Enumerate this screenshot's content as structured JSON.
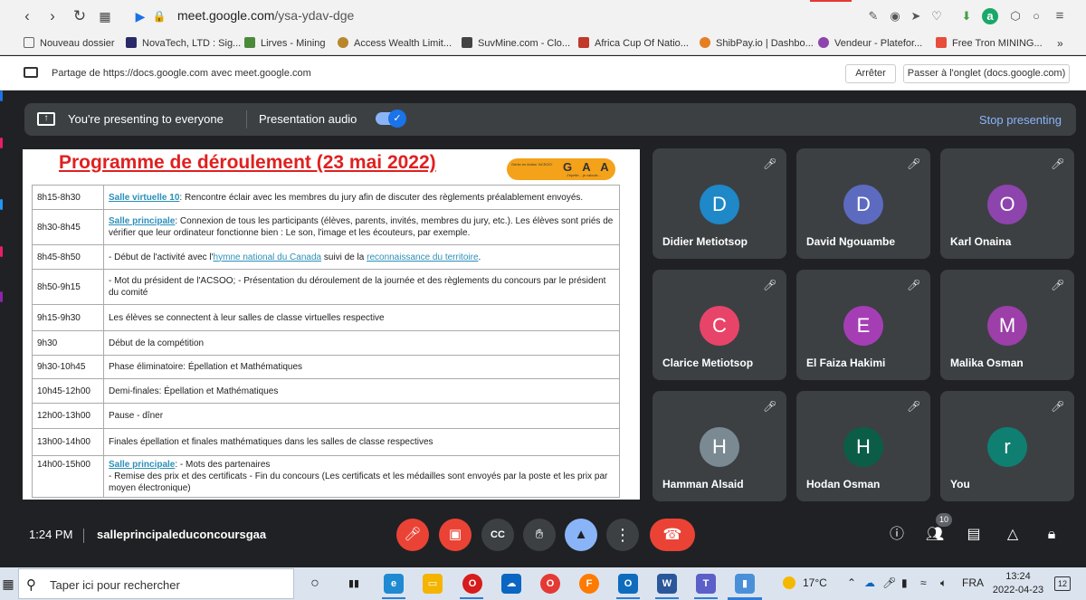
{
  "browser": {
    "url_host": "meet.google.com",
    "url_path": "/ysa-ydav-dge",
    "bookmarks": [
      {
        "label": "Nouveau dossier",
        "color": "#888888"
      },
      {
        "label": "NovaTech, LTD : Sig...",
        "color": "#2a2a6a"
      },
      {
        "label": "Lirves - Mining",
        "color": "#4a8a3a"
      },
      {
        "label": "Access Wealth Limit...",
        "color": "#b8862b"
      },
      {
        "label": "SuvMine.com - Clo...",
        "color": "#444444"
      },
      {
        "label": "Africa Cup Of Natio...",
        "color": "#c0392b"
      },
      {
        "label": "ShibPay.io | Dashbo...",
        "color": "#e67e22"
      },
      {
        "label": "Vendeur - Platefor...",
        "color": "#8e44ad"
      },
      {
        "label": "Free Tron MINING...",
        "color": "#e74c3c"
      }
    ],
    "more": "»"
  },
  "share_bar": {
    "text": "Partage de https://docs.google.com avec meet.google.com",
    "stop_label": "Arrêter",
    "switch_label": "Passer à l'onglet (docs.google.com)"
  },
  "presenting_bar": {
    "status": "You're presenting to everyone",
    "audio_label": "Presentation audio",
    "stop_label": "Stop presenting"
  },
  "document": {
    "title": "Programme de déroulement (23 mai 2022)",
    "logo_text": "G A A",
    "logo_small": "Génie en Action 'ACSOO'",
    "logo_tagline": "J'épelle... je calcule...",
    "rows": [
      {
        "time": "8h15-8h30",
        "link": "Salle virtuelle 10",
        "text": ": Rencontre éclair avec les membres du jury afin de discuter des règlements préalablement envoyés."
      },
      {
        "time": "8h30-8h45",
        "link": "Salle principale",
        "text": ": Connexion de tous les participants (élèves, parents, invités, membres du jury, etc.). Les élèves sont priés de vérifier que leur ordinateur fonctionne bien : Le son, l'image et les écouteurs, par exemple."
      },
      {
        "time": "8h45-8h50",
        "pre": "- Début de l'activité avec l'",
        "link1": "hymne national du Canada",
        "mid": " suivi de la ",
        "link2": "reconnaissance du territoire",
        "post": "."
      },
      {
        "time": "8h50-9h15",
        "text": "- Mot du président de l'ACSOO; - Présentation du déroulement de la journée et des règlements du concours par le président du comité"
      },
      {
        "time": "9h15-9h30",
        "text": "Les élèves se connectent à leur salles de classe virtuelles respective"
      },
      {
        "time": "9h30",
        "text": "Début de la compétition"
      },
      {
        "time": "9h30-10h45",
        "text": "Phase éliminatoire: Épellation et  Mathématiques"
      },
      {
        "time": "10h45-12h00",
        "text": "Demi-finales: Épellation et Mathématiques"
      },
      {
        "time": "12h00-13h00",
        "text": "Pause - dîner"
      },
      {
        "time": "13h00-14h00",
        "text": "Finales épellation et finales mathématiques dans les salles de classe respectives"
      },
      {
        "time": "14h00-15h00",
        "link": "Salle principale",
        "text": ": - Mots des partenaires",
        "text2": "- Remise des prix et des certificats - Fin du concours (Les certificats et les médailles sont envoyés par la poste et les prix par moyen électronique)"
      }
    ]
  },
  "participants": [
    {
      "name": "Didier Metiotsop",
      "initial": "D",
      "color": "#1e88c8"
    },
    {
      "name": "David Ngouambe",
      "initial": "D",
      "color": "#5c6bc0"
    },
    {
      "name": "Karl Onaina",
      "initial": "O",
      "color": "#8e44ad"
    },
    {
      "name": "Clarice Metiotsop",
      "initial": "C",
      "color": "#e8446a"
    },
    {
      "name": "El Faiza Hakimi",
      "initial": "E",
      "color": "#a53eb5"
    },
    {
      "name": "Malika Osman",
      "initial": "M",
      "color": "#9c3fa8"
    },
    {
      "name": "Hamman Alsaid",
      "initial": "H",
      "color": "#7b8a92"
    },
    {
      "name": "Hodan Osman",
      "initial": "H",
      "color": "#0b5d47"
    },
    {
      "name": "You",
      "initial": "r",
      "color": "#0f7f72"
    }
  ],
  "bottom_bar": {
    "time": "1:24 PM",
    "meeting_code": "salleprincipaleduconcoursgaa",
    "people_count": "10"
  },
  "taskbar": {
    "search_placeholder": "Taper ici pour rechercher",
    "temperature": "17°C",
    "language": "FRA",
    "time": "13:24",
    "date": "2022-04-23",
    "notifications": "12",
    "apps": [
      {
        "name": "task-view",
        "color": "#555555",
        "glyph": "▯▯"
      },
      {
        "name": "edge",
        "color": "#1f8ad2",
        "glyph": "e"
      },
      {
        "name": "file-explorer",
        "color": "#f4b400",
        "glyph": "▭"
      },
      {
        "name": "opera-red",
        "color": "#d81b1b",
        "glyph": "O"
      },
      {
        "name": "onedrive",
        "color": "#0a66c2",
        "glyph": "☁"
      },
      {
        "name": "opera",
        "color": "#e53935",
        "glyph": "O"
      },
      {
        "name": "firefox",
        "color": "#ff7a00",
        "glyph": "F"
      },
      {
        "name": "outlook",
        "color": "#0f6cbd",
        "glyph": "O"
      },
      {
        "name": "word",
        "color": "#2b579a",
        "glyph": "W"
      },
      {
        "name": "teams",
        "color": "#5b5fc7",
        "glyph": "T"
      },
      {
        "name": "meet-app",
        "color": "#4a90d9",
        "glyph": "▮"
      }
    ]
  }
}
